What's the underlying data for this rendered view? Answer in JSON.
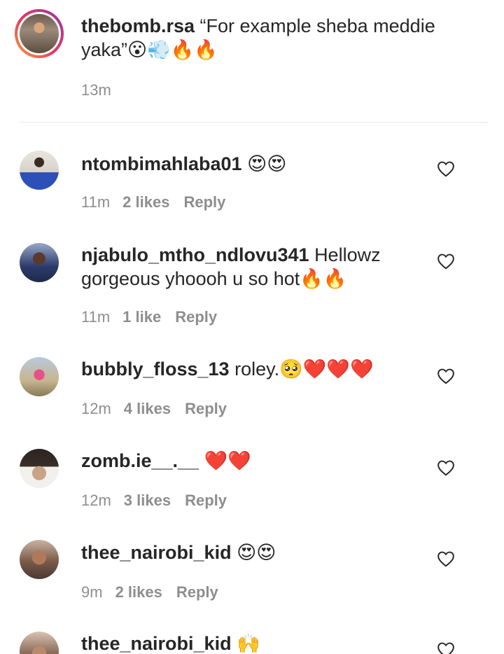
{
  "caption": {
    "username": "thebomb.rsa",
    "text": "“For example sheba meddie yaka”😮💨🔥🔥",
    "time": "13m"
  },
  "comments": [
    {
      "username": "ntombimahlaba01",
      "text": "😍😍",
      "time": "11m",
      "likes": "2 likes",
      "reply": "Reply",
      "avatar_color": "#c9c2b8"
    },
    {
      "username": "njabulo_mtho_ndlovu341",
      "text": "Hellowz gorgeous yhoooh u so hot🔥🔥",
      "time": "11m",
      "likes": "1 like",
      "reply": "Reply",
      "avatar_color": "#2b3b6b"
    },
    {
      "username": "bubbly_floss_13",
      "text": "roley.🥺❤️❤️❤️",
      "time": "12m",
      "likes": "4 likes",
      "reply": "Reply",
      "avatar_color": "#8fa0b8"
    },
    {
      "username": "zomb.ie__.__",
      "text": "❤️❤️",
      "time": "12m",
      "likes": "3 likes",
      "reply": "Reply",
      "avatar_color": "#3a2e28"
    },
    {
      "username": "thee_nairobi_kid",
      "text": "😍😍",
      "time": "9m",
      "likes": "2 likes",
      "reply": "Reply",
      "avatar_color": "#7a5a48"
    },
    {
      "username": "thee_nairobi_kid",
      "text": "🙌",
      "time": "",
      "likes": "",
      "reply": "",
      "avatar_color": "#8a6a58"
    }
  ],
  "icons": {
    "like": "heart-outline-icon"
  },
  "colors": {
    "text": "#262626",
    "meta": "#8e8e8e",
    "story_ring_start": "#f9a23b",
    "story_ring_end": "#8a3ab9"
  }
}
